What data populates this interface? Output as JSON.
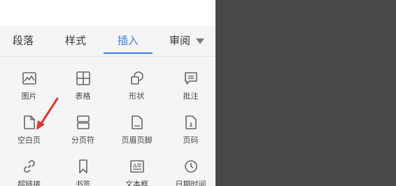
{
  "tabs": [
    {
      "label": "段落",
      "active": false
    },
    {
      "label": "样式",
      "active": false
    },
    {
      "label": "插入",
      "active": true
    },
    {
      "label": "审阅",
      "active": false
    }
  ],
  "accent_color": "#3d7be0",
  "more_icon": "triangle-down-icon",
  "grid": {
    "rows": [
      [
        {
          "label": "图片",
          "icon": "image-icon"
        },
        {
          "label": "表格",
          "icon": "table-icon"
        },
        {
          "label": "形状",
          "icon": "shape-icon"
        },
        {
          "label": "批注",
          "icon": "comment-icon"
        }
      ],
      [
        {
          "label": "空白页",
          "icon": "blank-page-icon"
        },
        {
          "label": "分页符",
          "icon": "page-break-icon"
        },
        {
          "label": "页眉页脚",
          "icon": "header-footer-icon"
        },
        {
          "label": "页码",
          "icon": "page-number-icon"
        }
      ],
      [
        {
          "label": "超链接",
          "icon": "link-icon"
        },
        {
          "label": "书签",
          "icon": "bookmark-icon"
        },
        {
          "label": "文本框",
          "icon": "textbox-icon"
        },
        {
          "label": "日期时间",
          "icon": "clock-icon"
        }
      ]
    ]
  },
  "annotation": {
    "icon": "red-arrow-icon",
    "color": "#e2352a"
  }
}
